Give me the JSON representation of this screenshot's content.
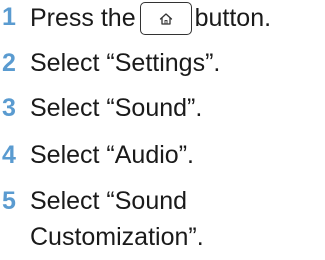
{
  "steps": [
    {
      "number": "1",
      "text_before": "Press the",
      "text_after": "button."
    },
    {
      "number": "2",
      "text": "Select “Settings”."
    },
    {
      "number": "3",
      "text": "Select “Sound”."
    },
    {
      "number": "4",
      "text": "Select “Audio”."
    },
    {
      "number": "5",
      "text_line1": "Select “Sound",
      "text_line2": "Customization”."
    }
  ],
  "colors": {
    "step_number": "#5a9bd0",
    "text": "#1a1a1a",
    "button_border": "#333333"
  },
  "icons": {
    "remote_button": "home-icon"
  }
}
